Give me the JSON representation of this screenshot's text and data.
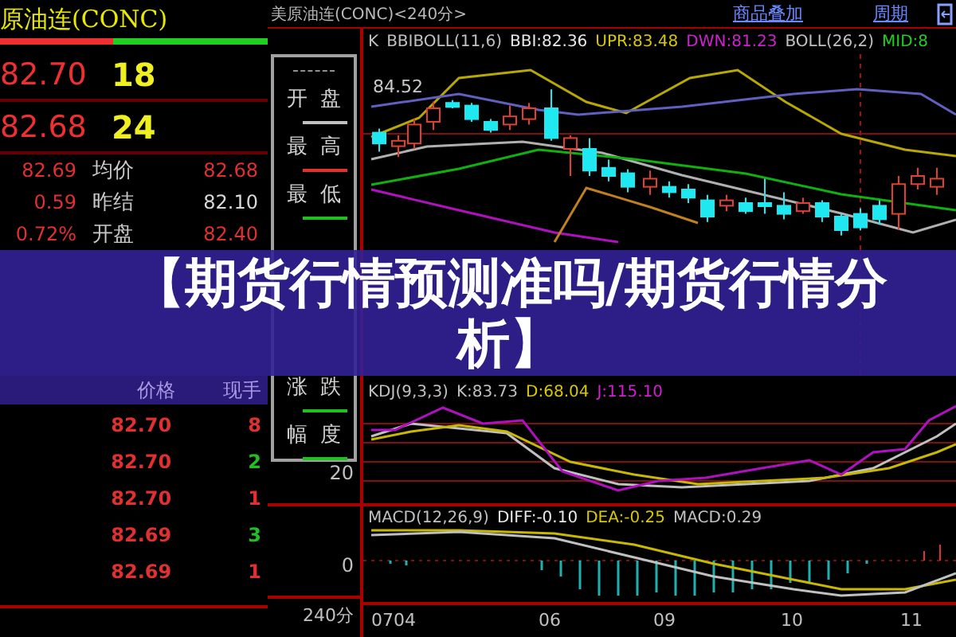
{
  "quote_panel": {
    "title": "原油连(CONC)",
    "buy_sell_bar": {
      "level": 0.42
    },
    "best_quotes": [
      {
        "price": "82.70",
        "volume": "18"
      },
      {
        "price": "82.68",
        "volume": "24"
      }
    ],
    "stats": [
      {
        "figure": "82.69",
        "label": "均价",
        "value": "82.68",
        "color": "#e03030"
      },
      {
        "figure": "0.59",
        "label": "昨结",
        "value": "82.10",
        "color": "#d8d8d8"
      },
      {
        "figure": "0.72%",
        "label": "开盘",
        "value": "82.40",
        "color": "#e03030"
      }
    ],
    "ticks_header": [
      "价格",
      "现手"
    ],
    "ticks": [
      {
        "price": "82.70",
        "volume": "8",
        "color": "#e03030"
      },
      {
        "price": "82.70",
        "volume": "2",
        "color": "#20c020"
      },
      {
        "price": "82.70",
        "volume": "1",
        "color": "#e03030"
      },
      {
        "price": "82.69",
        "volume": "3",
        "color": "#20c020"
      },
      {
        "price": "82.69",
        "volume": "1",
        "color": "#e03030"
      }
    ]
  },
  "popup_menu": {
    "items": [
      {
        "left": "开",
        "right": "盘",
        "color": "#c0c0c0"
      },
      {
        "left": "最",
        "right": "高",
        "color": "#e03030"
      },
      {
        "left": "最",
        "right": "低",
        "color": "#20c020"
      }
    ],
    "lower_items": [
      {
        "left": "涨",
        "right": "跌",
        "color": "#20c020"
      },
      {
        "left": "幅",
        "right": "度",
        "color": "#20c020"
      }
    ]
  },
  "side_readings": [
    "20",
    "0"
  ],
  "axis_unit": "240分",
  "chart": {
    "title": "美原油连(CONC)<240分>",
    "links": [
      "商品叠加",
      "周期"
    ],
    "main_indicators": [
      {
        "text": "K",
        "color": "#c0c0c0"
      },
      {
        "text": "BBIBOLL(11,6)",
        "color": "#c0c0c0"
      },
      {
        "text": "BBI:82.36",
        "color": "#e8e8e8"
      },
      {
        "text": "UPR:83.48",
        "color": "#d8c800"
      },
      {
        "text": "DWN:81.23",
        "color": "#d020d0"
      },
      {
        "text": "BOLL(26,2)",
        "color": "#c0c0c0"
      },
      {
        "text": "MID:8",
        "color": "#20d020"
      }
    ],
    "price_label": "84.52",
    "kdj_indicators": [
      {
        "text": "KDJ(9,3,3)",
        "color": "#c0c0c0"
      },
      {
        "text": "K:83.73",
        "color": "#c0c0c0"
      },
      {
        "text": "D:68.04",
        "color": "#d8c800"
      },
      {
        "text": "J:115.10",
        "color": "#d020d0"
      }
    ],
    "macd_indicators": [
      {
        "text": "MACD(12,26,9)",
        "color": "#c0c0c0"
      },
      {
        "text": "DIFF:-0.10",
        "color": "#e8e8e8"
      },
      {
        "text": "DEA:-0.25",
        "color": "#d8c800"
      },
      {
        "text": "MACD:0.29",
        "color": "#c0c0c0"
      }
    ],
    "x_axis": [
      "0704",
      "06",
      "09",
      "10",
      "11"
    ]
  },
  "banner": {
    "title": "【期货行情预测准吗/期货行情分析】"
  }
}
